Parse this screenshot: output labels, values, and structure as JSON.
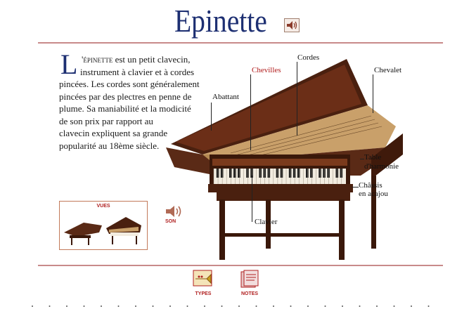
{
  "page": {
    "title": "Epinette",
    "speaker_icon": "speaker-icon"
  },
  "intro": {
    "dropcap": "L",
    "lead": "'épinette",
    "lines": [
      "est un petit clavecin,",
      "instrument à clavier et à cordes",
      "pincées. Les cordes sont généralement",
      "pincées par des plectres en penne de",
      "plume. Sa maniabilité et la modicité",
      "de son prix par rapport au",
      "clavecin expliquent sa grande",
      "popularité au 18ème siècle."
    ]
  },
  "labels": {
    "cordes": "Cordes",
    "chevilles": "Chevilles",
    "chevalet": "Chevalet",
    "abattant": "Abattant",
    "table_line1": "Table",
    "table_line2": "d'harmonie",
    "chassis_line1": "Châssis",
    "chassis_line2": "en acajou",
    "clavier": "Clavier"
  },
  "views": {
    "title": "VUES"
  },
  "sound": {
    "label": "SON"
  },
  "nav": {
    "types": "TYPES",
    "notes": "NOTES"
  },
  "colors": {
    "title": "#1d2f72",
    "accent_red": "#b01a1a",
    "rule": "#c88a8a",
    "wood": "#5a2a16"
  }
}
